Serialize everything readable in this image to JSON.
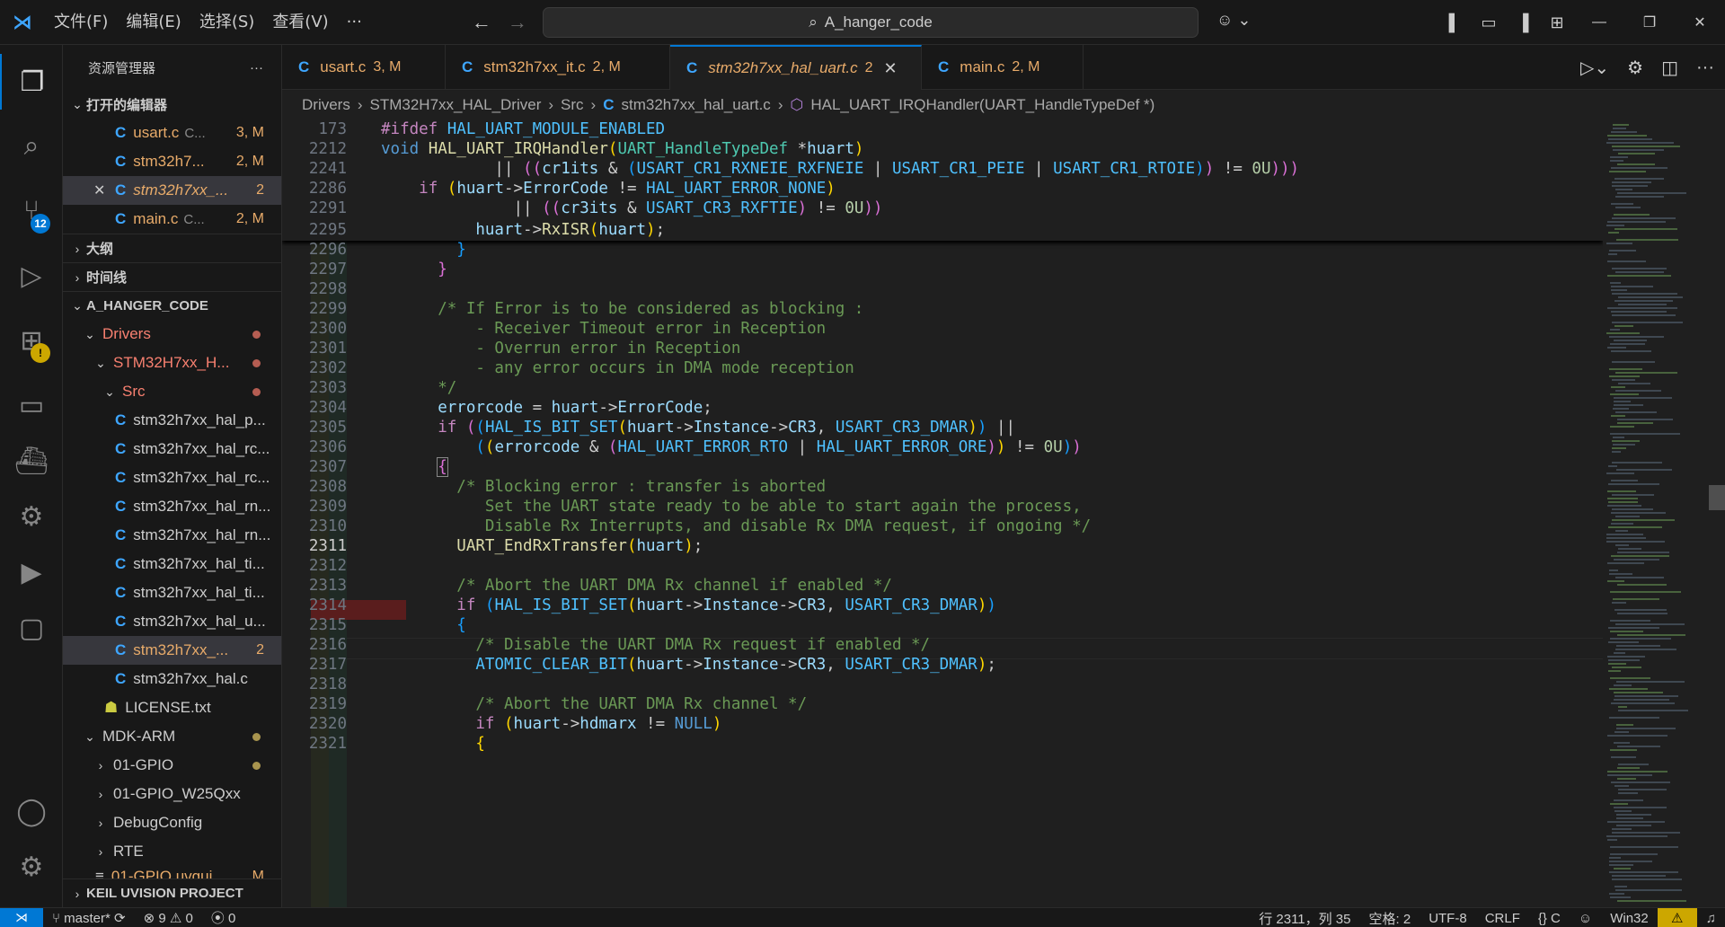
{
  "titlebar": {
    "menus": [
      "文件(F)",
      "编辑(E)",
      "选择(S)",
      "查看(V)",
      "···"
    ],
    "search_text": "A_hanger_code"
  },
  "activity": {
    "scm_badge": "12"
  },
  "sidebar": {
    "title": "资源管理器",
    "more": "···",
    "open_editors": {
      "header": "打开的编辑器",
      "items": [
        {
          "name": "usart.c",
          "path": "C...",
          "meta": "3, M"
        },
        {
          "name": "stm32h7...",
          "path": "C...",
          "meta": "2, M"
        },
        {
          "name": "stm32h7xx_...",
          "path": "",
          "meta": "2"
        },
        {
          "name": "main.c",
          "path": "C...",
          "meta": "2, M"
        }
      ]
    },
    "outline": "大纲",
    "timeline": "时间线",
    "project": {
      "header": "A_HANGER_CODE",
      "drivers": "Drivers",
      "hal": "STM32H7xx_H...",
      "src": "Src",
      "files": [
        "stm32h7xx_hal_p...",
        "stm32h7xx_hal_rc...",
        "stm32h7xx_hal_rc...",
        "stm32h7xx_hal_rn...",
        "stm32h7xx_hal_rn...",
        "stm32h7xx_hal_ti...",
        "stm32h7xx_hal_ti...",
        "stm32h7xx_hal_u...",
        "stm32h7xx_...",
        "stm32h7xx_hal.c"
      ],
      "selected_badge": "2",
      "license": "LICENSE.txt",
      "mdk": "MDK-ARM",
      "folders": [
        "01-GPIO",
        "01-GPIO_W25Qxx",
        "DebugConfig",
        "RTE"
      ],
      "uvgui": "01-GPIO.uvgui...",
      "uvgui_meta": "M"
    },
    "keil": "KEIL UVISION PROJECT"
  },
  "tabs": [
    {
      "name": "usart.c",
      "count": "3, M"
    },
    {
      "name": "stm32h7xx_it.c",
      "count": "2, M"
    },
    {
      "name": "stm32h7xx_hal_uart.c",
      "count": "2"
    },
    {
      "name": "main.c",
      "count": "2, M"
    }
  ],
  "breadcrumb": [
    "Drivers",
    "STM32H7xx_HAL_Driver",
    "Src",
    "stm32h7xx_hal_uart.c",
    "HAL_UART_IRQHandler(UART_HandleTypeDef *)"
  ],
  "line_numbers": {
    "sticky": [
      "173",
      "2212",
      "2241",
      "2286",
      "2291"
    ],
    "body": [
      "2295",
      "2296",
      "2297",
      "2298",
      "2299",
      "2300",
      "2301",
      "2302",
      "2303",
      "2304",
      "2305",
      "2306",
      "2307",
      "2308",
      "2309",
      "2310",
      "2311",
      "2312",
      "2313",
      "2314",
      "2315",
      "2316",
      "2317",
      "2318",
      "2319",
      "2320",
      "2321"
    ]
  },
  "status": {
    "branch": "master*",
    "errors": "9",
    "warnings": "0",
    "ports": "0",
    "position": "行 2311，列 35",
    "spaces": "空格: 2",
    "encoding": "UTF-8",
    "eol": "CRLF",
    "language": "C",
    "config": "Win32"
  },
  "colors": {
    "accent": "#0078d4",
    "modified": "#e8ab6a",
    "error": "#f88070",
    "warning": "#cca700"
  }
}
